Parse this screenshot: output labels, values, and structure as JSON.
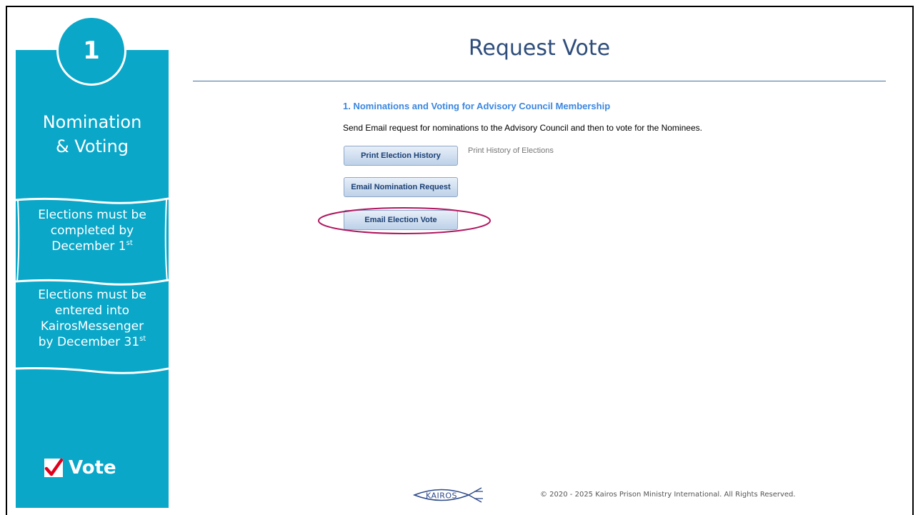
{
  "sidebar": {
    "step_number": "1",
    "title_line1": "Nomination",
    "title_line2": "& Voting",
    "note1": {
      "line1": "Elections must be",
      "line2": "completed by",
      "line3": "December 1",
      "sup": "st"
    },
    "note2": {
      "line1": "Elections must be",
      "line2": "entered into",
      "line3": "KairosMessenger",
      "line4": "by December 31",
      "sup": "st"
    },
    "vote_label": "Vote",
    "vote_icon": "check-icon",
    "colors": {
      "panel": "#0aa7c9",
      "check": "#e0001a"
    }
  },
  "page": {
    "title": "Request Vote",
    "section_heading": "1. Nominations and Voting for Advisory Council Membership",
    "section_desc": "Send Email request for nominations to the Advisory Council and then to vote for the Nominees.",
    "buttons": {
      "print_history": "Print Election History",
      "print_history_note": "Print History of Elections",
      "email_nomination": "Email Nomination Request",
      "email_vote": "Email Election Vote"
    },
    "highlight_color": "#b0175f"
  },
  "footer": {
    "logo_text": "KAIROS",
    "copyright": "© 2020 - 2025 Kairos Prison Ministry International. All Rights Reserved."
  }
}
